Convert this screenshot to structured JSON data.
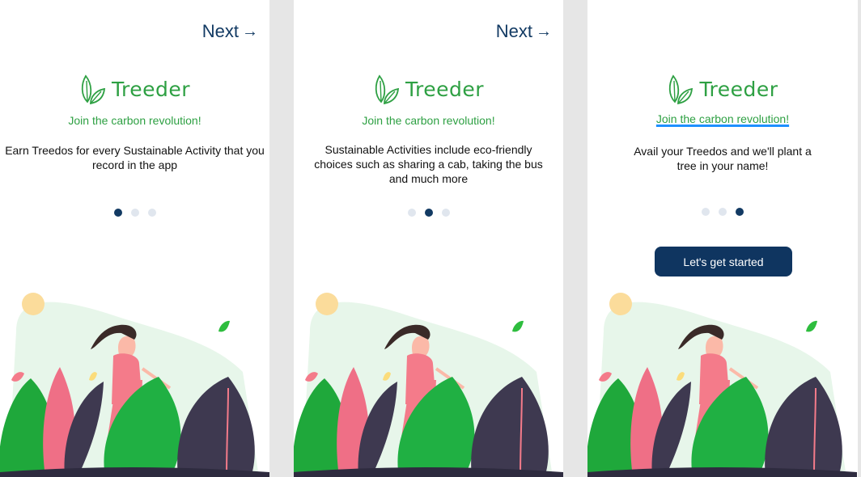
{
  "colors": {
    "brand_green": "#2ea043",
    "navy": "#123a63",
    "dot_inactive": "#e0e6ee",
    "underline_blue": "#1e90ff"
  },
  "screens": [
    {
      "next_label": "Next",
      "logo_text": "Treeder",
      "tagline": "Join the carbon revolution!",
      "description": "Earn Treedos for every Sustainable Activity that you record in the app",
      "pagination": {
        "total": 3,
        "active": 1
      }
    },
    {
      "next_label": "Next",
      "logo_text": "Treeder",
      "tagline": "Join the carbon revolution!",
      "description": "Sustainable Activities include eco-friendly choices such as sharing a cab, taking the bus and much more",
      "pagination": {
        "total": 3,
        "active": 2
      }
    },
    {
      "logo_text": "Treeder",
      "tagline": "Join the carbon revolution!",
      "description": "Avail your Treedos and we'll plant a tree in your name!",
      "pagination": {
        "total": 3,
        "active": 3
      },
      "cta_label": "Let's get started"
    }
  ],
  "icons": {
    "next_arrow": "arrow-right-icon",
    "logo": "leaf-logo-icon"
  }
}
